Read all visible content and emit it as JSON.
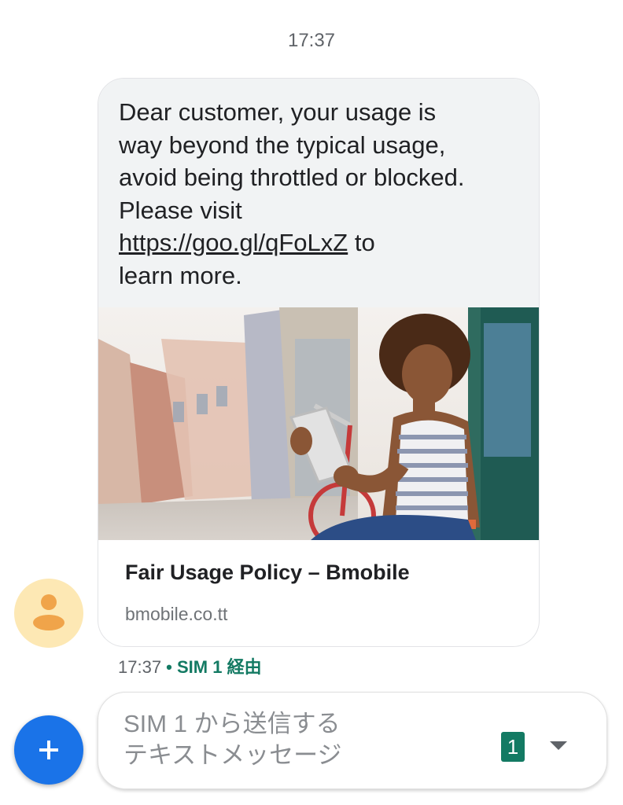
{
  "thread": {
    "date_time": "17:37"
  },
  "message": {
    "line1": "Dear customer, your usage is",
    "line2": "way beyond the typical usage,",
    "line3": "avoid being throttled or blocked.",
    "line4": "Please visit",
    "link": "https://goo.gl/qFoLxZ",
    "after_link": " to",
    "line6": "learn more.",
    "preview": {
      "title": "Fair Usage Policy – Bmobile",
      "domain": "bmobile.co.tt"
    },
    "meta": {
      "time": "17:37",
      "separator": " • ",
      "sim": "SIM 1 経由"
    }
  },
  "compose": {
    "placeholder_line1": "SIM 1 から送信する",
    "placeholder_line2": "テキストメッセージ",
    "sim_badge": "1"
  },
  "colors": {
    "accent": "#1a73e8",
    "sim_green": "#137a63",
    "bubble_bg": "#f1f3f4",
    "avatar_bg": "#fde8b4",
    "avatar_fg": "#f0a44a"
  },
  "icons": {
    "avatar": "person-icon",
    "fab": "plus-icon",
    "dropdown": "chevron-down-icon"
  }
}
